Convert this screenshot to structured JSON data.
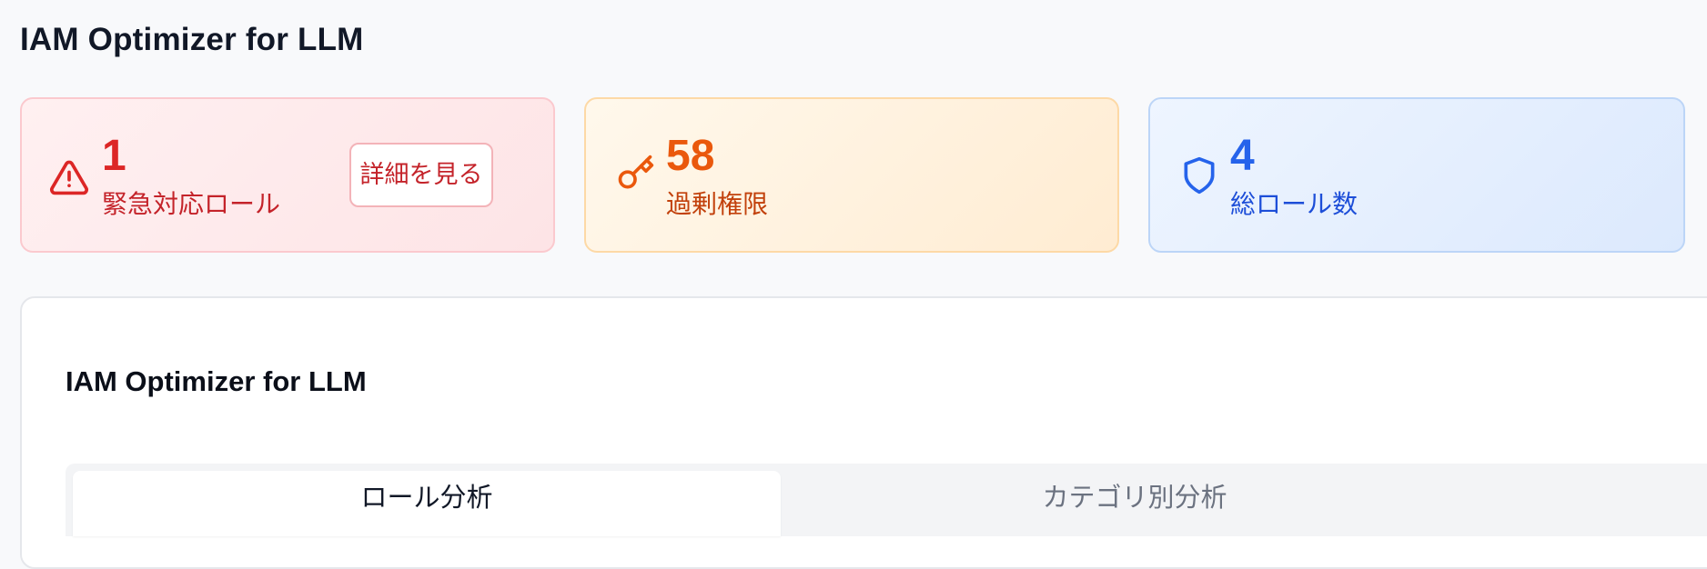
{
  "header": {
    "title": "IAM Optimizer for LLM"
  },
  "cards": {
    "urgent": {
      "value": "1",
      "label": "緊急対応ロール",
      "button_label": "詳細を見る",
      "icon": "warning-triangle-icon",
      "color": "#dc2626"
    },
    "excess": {
      "value": "58",
      "label": "過剰権限",
      "icon": "key-icon",
      "color": "#ea580c"
    },
    "total": {
      "value": "4",
      "label": "総ロール数",
      "icon": "shield-icon",
      "color": "#2563eb"
    }
  },
  "main": {
    "title": "IAM Optimizer for LLM",
    "tabs": [
      {
        "label": "ロール分析",
        "active": true
      },
      {
        "label": "カテゴリ別分析",
        "active": false
      }
    ]
  }
}
